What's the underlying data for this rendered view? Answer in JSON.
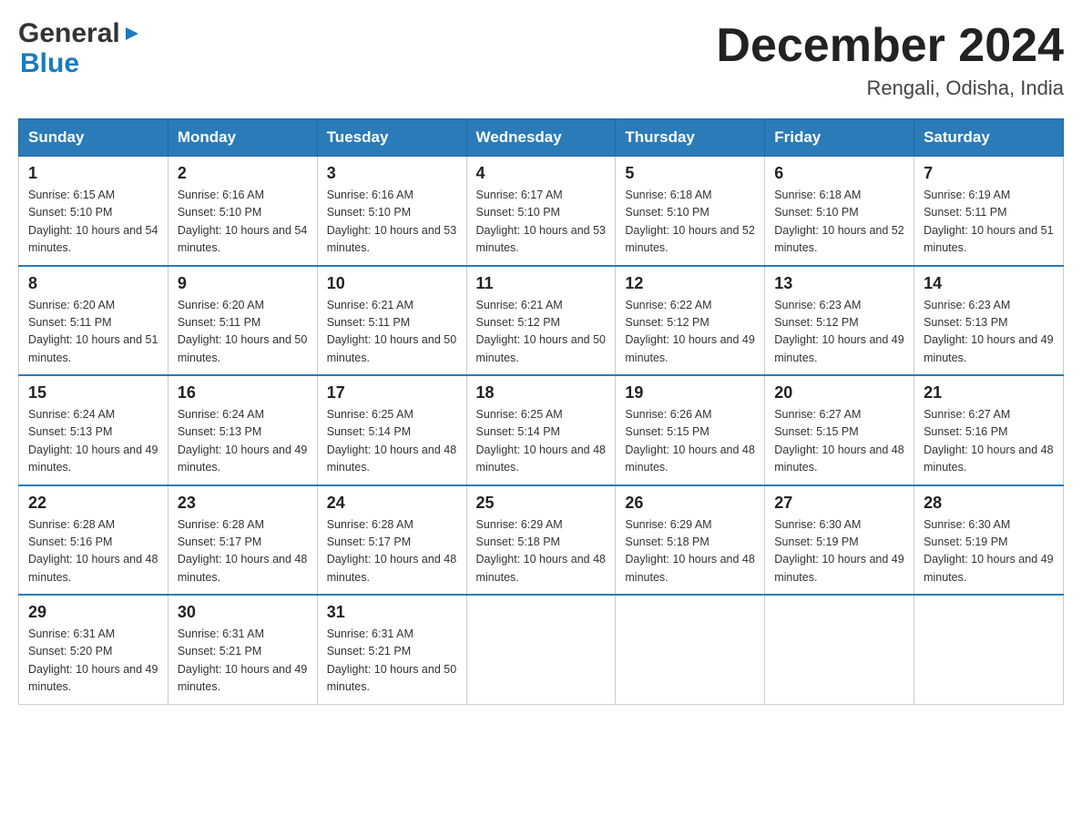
{
  "header": {
    "logo_general": "General",
    "logo_blue": "Blue",
    "month_title": "December 2024",
    "location": "Rengali, Odisha, India"
  },
  "weekdays": [
    "Sunday",
    "Monday",
    "Tuesday",
    "Wednesday",
    "Thursday",
    "Friday",
    "Saturday"
  ],
  "weeks": [
    [
      {
        "day": "1",
        "sunrise": "6:15 AM",
        "sunset": "5:10 PM",
        "daylight": "10 hours and 54 minutes."
      },
      {
        "day": "2",
        "sunrise": "6:16 AM",
        "sunset": "5:10 PM",
        "daylight": "10 hours and 54 minutes."
      },
      {
        "day": "3",
        "sunrise": "6:16 AM",
        "sunset": "5:10 PM",
        "daylight": "10 hours and 53 minutes."
      },
      {
        "day": "4",
        "sunrise": "6:17 AM",
        "sunset": "5:10 PM",
        "daylight": "10 hours and 53 minutes."
      },
      {
        "day": "5",
        "sunrise": "6:18 AM",
        "sunset": "5:10 PM",
        "daylight": "10 hours and 52 minutes."
      },
      {
        "day": "6",
        "sunrise": "6:18 AM",
        "sunset": "5:10 PM",
        "daylight": "10 hours and 52 minutes."
      },
      {
        "day": "7",
        "sunrise": "6:19 AM",
        "sunset": "5:11 PM",
        "daylight": "10 hours and 51 minutes."
      }
    ],
    [
      {
        "day": "8",
        "sunrise": "6:20 AM",
        "sunset": "5:11 PM",
        "daylight": "10 hours and 51 minutes."
      },
      {
        "day": "9",
        "sunrise": "6:20 AM",
        "sunset": "5:11 PM",
        "daylight": "10 hours and 50 minutes."
      },
      {
        "day": "10",
        "sunrise": "6:21 AM",
        "sunset": "5:11 PM",
        "daylight": "10 hours and 50 minutes."
      },
      {
        "day": "11",
        "sunrise": "6:21 AM",
        "sunset": "5:12 PM",
        "daylight": "10 hours and 50 minutes."
      },
      {
        "day": "12",
        "sunrise": "6:22 AM",
        "sunset": "5:12 PM",
        "daylight": "10 hours and 49 minutes."
      },
      {
        "day": "13",
        "sunrise": "6:23 AM",
        "sunset": "5:12 PM",
        "daylight": "10 hours and 49 minutes."
      },
      {
        "day": "14",
        "sunrise": "6:23 AM",
        "sunset": "5:13 PM",
        "daylight": "10 hours and 49 minutes."
      }
    ],
    [
      {
        "day": "15",
        "sunrise": "6:24 AM",
        "sunset": "5:13 PM",
        "daylight": "10 hours and 49 minutes."
      },
      {
        "day": "16",
        "sunrise": "6:24 AM",
        "sunset": "5:13 PM",
        "daylight": "10 hours and 49 minutes."
      },
      {
        "day": "17",
        "sunrise": "6:25 AM",
        "sunset": "5:14 PM",
        "daylight": "10 hours and 48 minutes."
      },
      {
        "day": "18",
        "sunrise": "6:25 AM",
        "sunset": "5:14 PM",
        "daylight": "10 hours and 48 minutes."
      },
      {
        "day": "19",
        "sunrise": "6:26 AM",
        "sunset": "5:15 PM",
        "daylight": "10 hours and 48 minutes."
      },
      {
        "day": "20",
        "sunrise": "6:27 AM",
        "sunset": "5:15 PM",
        "daylight": "10 hours and 48 minutes."
      },
      {
        "day": "21",
        "sunrise": "6:27 AM",
        "sunset": "5:16 PM",
        "daylight": "10 hours and 48 minutes."
      }
    ],
    [
      {
        "day": "22",
        "sunrise": "6:28 AM",
        "sunset": "5:16 PM",
        "daylight": "10 hours and 48 minutes."
      },
      {
        "day": "23",
        "sunrise": "6:28 AM",
        "sunset": "5:17 PM",
        "daylight": "10 hours and 48 minutes."
      },
      {
        "day": "24",
        "sunrise": "6:28 AM",
        "sunset": "5:17 PM",
        "daylight": "10 hours and 48 minutes."
      },
      {
        "day": "25",
        "sunrise": "6:29 AM",
        "sunset": "5:18 PM",
        "daylight": "10 hours and 48 minutes."
      },
      {
        "day": "26",
        "sunrise": "6:29 AM",
        "sunset": "5:18 PM",
        "daylight": "10 hours and 48 minutes."
      },
      {
        "day": "27",
        "sunrise": "6:30 AM",
        "sunset": "5:19 PM",
        "daylight": "10 hours and 49 minutes."
      },
      {
        "day": "28",
        "sunrise": "6:30 AM",
        "sunset": "5:19 PM",
        "daylight": "10 hours and 49 minutes."
      }
    ],
    [
      {
        "day": "29",
        "sunrise": "6:31 AM",
        "sunset": "5:20 PM",
        "daylight": "10 hours and 49 minutes."
      },
      {
        "day": "30",
        "sunrise": "6:31 AM",
        "sunset": "5:21 PM",
        "daylight": "10 hours and 49 minutes."
      },
      {
        "day": "31",
        "sunrise": "6:31 AM",
        "sunset": "5:21 PM",
        "daylight": "10 hours and 50 minutes."
      },
      null,
      null,
      null,
      null
    ]
  ]
}
